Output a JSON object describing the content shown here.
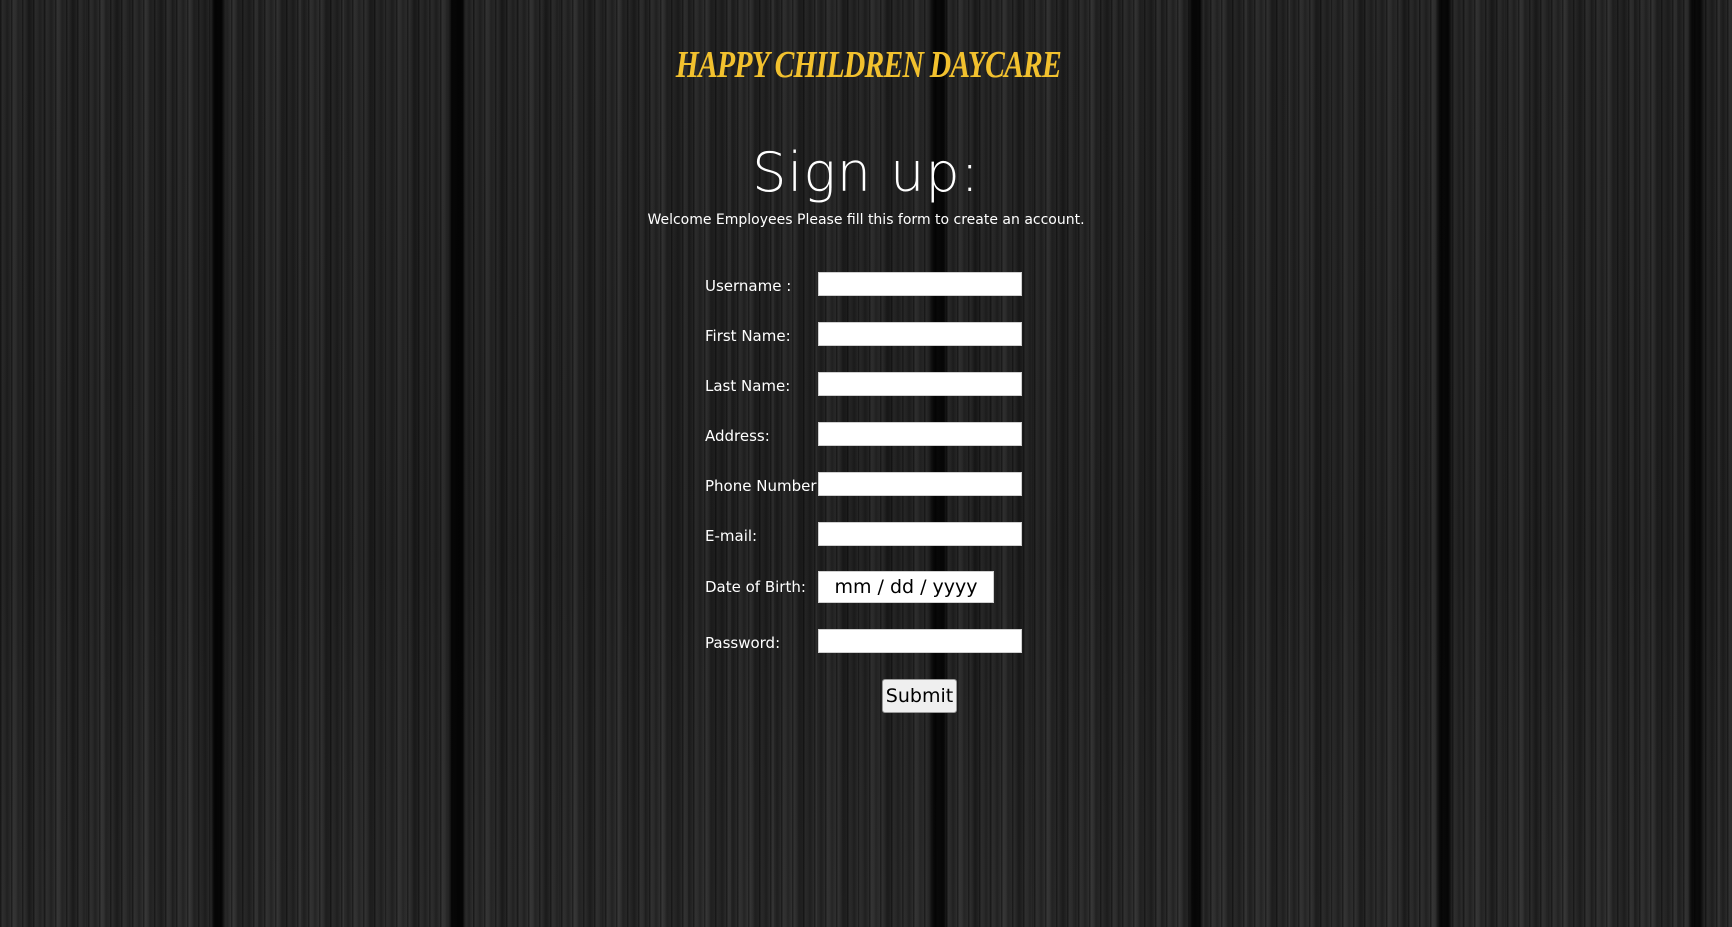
{
  "header": {
    "brand_title": "HAPPY CHILDREN DAYCARE"
  },
  "main": {
    "heading": "Sign up:",
    "subtitle": "Welcome Employees Please fill this form to create an account."
  },
  "form": {
    "fields": [
      {
        "label": "Username :",
        "value": ""
      },
      {
        "label": "First Name:",
        "value": ""
      },
      {
        "label": "Last Name:",
        "value": ""
      },
      {
        "label": "Address:",
        "value": ""
      },
      {
        "label": "Phone Number:",
        "value": ""
      },
      {
        "label": "E-mail:",
        "value": ""
      },
      {
        "label": "Date of Birth:",
        "placeholder": "mm / dd / yyyy"
      },
      {
        "label": "Password:",
        "value": ""
      }
    ],
    "submit_label": "Submit"
  },
  "colors": {
    "brand_title": "#f2c12e",
    "text": "#ffffff",
    "background": "#2a2a2a"
  }
}
